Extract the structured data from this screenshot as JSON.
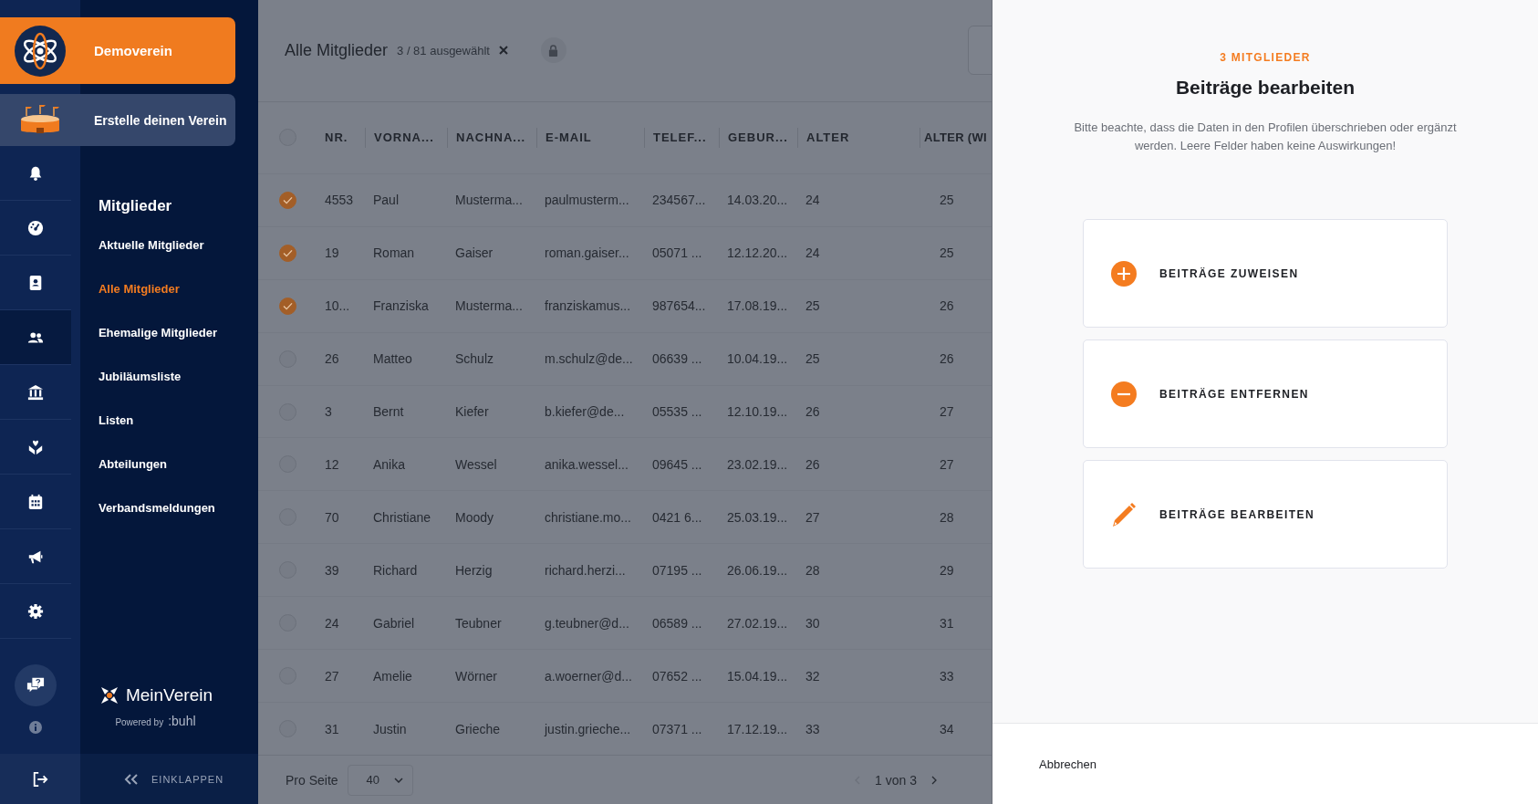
{
  "sidebar": {
    "club": "Demoverein",
    "create_club": "Erstelle deinen Verein",
    "rail": [
      {
        "selected": false
      },
      {
        "selected": false
      },
      {
        "selected": false
      },
      {
        "selected": true
      },
      {
        "selected": false
      },
      {
        "selected": false
      },
      {
        "selected": false
      },
      {
        "selected": false
      },
      {
        "selected": false
      }
    ],
    "nav": {
      "heading": "Mitglieder",
      "items": [
        {
          "label": "Aktuelle Mitglieder",
          "selected": false
        },
        {
          "label": "Alle Mitglieder",
          "selected": true
        },
        {
          "label": "Ehemalige Mitglieder",
          "selected": false
        },
        {
          "label": "Jubiläumsliste",
          "selected": false
        },
        {
          "label": "Listen",
          "selected": false
        },
        {
          "label": "Abteilungen",
          "selected": false
        },
        {
          "label": "Verbandsmeldungen",
          "selected": false
        }
      ]
    },
    "brand": {
      "name": "MeinVerein",
      "powered_by": "Powered by",
      "company": ":buhl"
    },
    "collapse": "EINKLAPPEN"
  },
  "main": {
    "title": "Alle Mitglieder",
    "selection": "3 / 81 ausgewählt",
    "table": {
      "header_checkbox": {
        "checked": false
      },
      "columns": [
        "NR.",
        "VORNA...",
        "NACHNA...",
        "E-MAIL",
        "TELEF...",
        "GEBUR...",
        "ALTER",
        "ALTER (WI"
      ],
      "rows": [
        {
          "selected": true,
          "cells": [
            "4553",
            "Paul",
            "Musterma...",
            "paulmusterm...",
            "234567...",
            "14.03.20...",
            "24",
            "25"
          ]
        },
        {
          "selected": true,
          "cells": [
            "19",
            "Roman",
            "Gaiser",
            "roman.gaiser...",
            "05071 ...",
            "12.12.20...",
            "24",
            "25"
          ]
        },
        {
          "selected": true,
          "cells": [
            "10...",
            "Franziska",
            "Musterma...",
            "franziskamus...",
            "987654...",
            "17.08.19...",
            "25",
            "26"
          ]
        },
        {
          "selected": false,
          "cells": [
            "26",
            "Matteo",
            "Schulz",
            "m.schulz@de...",
            "06639 ...",
            "10.04.19...",
            "25",
            "26"
          ]
        },
        {
          "selected": false,
          "cells": [
            "3",
            "Bernt",
            "Kiefer",
            "b.kiefer@de...",
            "05535 ...",
            "12.10.19...",
            "26",
            "27"
          ]
        },
        {
          "selected": false,
          "cells": [
            "12",
            "Anika",
            "Wessel",
            "anika.wessel...",
            "09645 ...",
            "23.02.19...",
            "26",
            "27"
          ]
        },
        {
          "selected": false,
          "cells": [
            "70",
            "Christiane",
            "Moody",
            "christiane.mo...",
            "0421 6...",
            "25.03.19...",
            "27",
            "28"
          ]
        },
        {
          "selected": false,
          "cells": [
            "39",
            "Richard",
            "Herzig",
            "richard.herzi...",
            "07195 ...",
            "26.06.19...",
            "28",
            "29"
          ]
        },
        {
          "selected": false,
          "cells": [
            "24",
            "Gabriel",
            "Teubner",
            "g.teubner@d...",
            "06589 ...",
            "27.02.19...",
            "30",
            "31"
          ]
        },
        {
          "selected": false,
          "cells": [
            "27",
            "Amelie",
            "Wörner",
            "a.woerner@d...",
            "07652 ...",
            "15.04.19...",
            "32",
            "33"
          ]
        },
        {
          "selected": false,
          "cells": [
            "31",
            "Justin",
            "Grieche",
            "justin.grieche...",
            "07371 ...",
            "17.12.19...",
            "33",
            "34"
          ]
        }
      ]
    },
    "footer": {
      "per_page_label": "Pro Seite",
      "per_page": "40",
      "pagination": "1 von 3"
    }
  },
  "panel": {
    "eyebrow": "3 MITGLIEDER",
    "title": "Beiträge bearbeiten",
    "description": "Bitte beachte, dass die Daten in den Profilen überschrieben oder ergänzt werden. Leere Felder haben keine Auswirkungen!",
    "actions": [
      {
        "kind": "add",
        "label": "BEITRÄGE ZUWEISEN"
      },
      {
        "kind": "remove",
        "label": "BEITRÄGE ENTFERNEN"
      },
      {
        "kind": "edit",
        "label": "BEITRÄGE BEARBEITEN"
      }
    ],
    "cancel": "Abbrechen"
  }
}
